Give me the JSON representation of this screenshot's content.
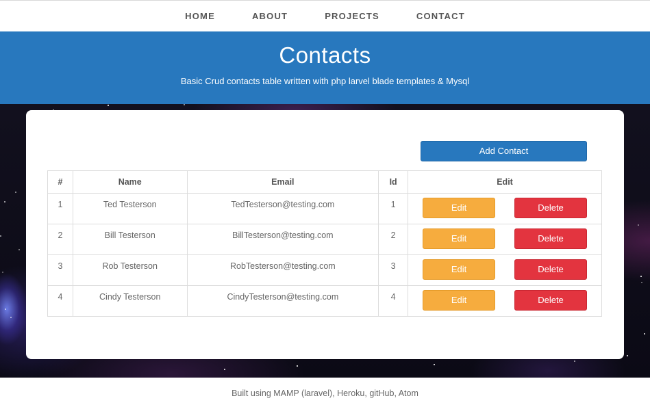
{
  "nav": {
    "items": [
      "HOME",
      "ABOUT",
      "PROJECTS",
      "CONTACT"
    ]
  },
  "hero": {
    "title": "Contacts",
    "subtitle": "Basic Crud contacts table written with php larvel blade templates & Mysql"
  },
  "main": {
    "add_button": "Add Contact",
    "table": {
      "headers": [
        "#",
        "Name",
        "Email",
        "Id",
        "Edit"
      ],
      "rows": [
        {
          "num": "1",
          "name": "Ted Testerson",
          "email": "TedTesterson@testing.com",
          "id": "1"
        },
        {
          "num": "2",
          "name": "Bill Testerson",
          "email": "BillTesterson@testing.com",
          "id": "2"
        },
        {
          "num": "3",
          "name": "Rob Testerson",
          "email": "RobTesterson@testing.com",
          "id": "3"
        },
        {
          "num": "4",
          "name": "Cindy Testerson",
          "email": "CindyTesterson@testing.com",
          "id": "4"
        }
      ],
      "edit_label": "Edit",
      "delete_label": "Delete"
    }
  },
  "footer": {
    "text": "Built using MAMP (laravel), Heroku, gitHub, Atom"
  },
  "colors": {
    "primary": "#2878be",
    "edit": "#f6ac3e",
    "delete": "#e3343f"
  }
}
